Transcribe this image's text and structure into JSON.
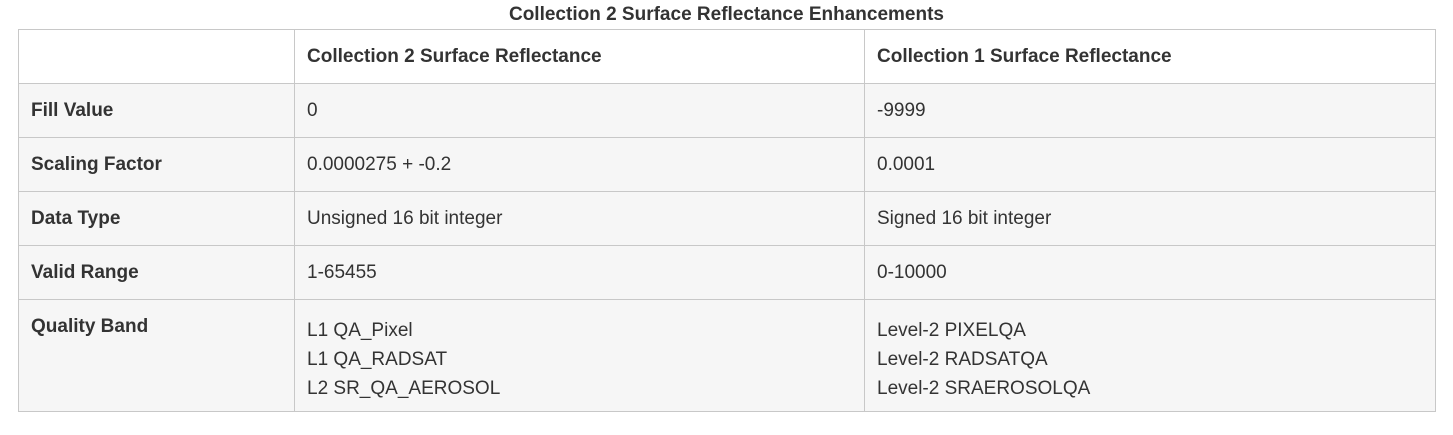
{
  "caption": "Collection 2 Surface Reflectance Enhancements",
  "table": {
    "headers": [
      "",
      "Collection 2 Surface Reflectance",
      "Collection 1 Surface Reflectance"
    ],
    "rows": [
      {
        "label": "Fill Value",
        "c2": [
          "0"
        ],
        "c1": [
          "-9999"
        ]
      },
      {
        "label": "Scaling Factor",
        "c2": [
          "0.0000275 + -0.2"
        ],
        "c1": [
          "0.0001"
        ]
      },
      {
        "label": "Data Type",
        "c2": [
          "Unsigned 16 bit integer"
        ],
        "c1": [
          "Signed 16 bit integer"
        ]
      },
      {
        "label": "Valid Range",
        "c2": [
          "1-65455"
        ],
        "c1": [
          "0-10000"
        ]
      },
      {
        "label": "Quality Band",
        "c2": [
          "L1 QA_Pixel",
          "L1 QA_RADSAT",
          "L2 SR_QA_AEROSOL"
        ],
        "c1": [
          "Level-2 PIXELQA",
          "Level-2 RADSATQA",
          "Level-2 SRAEROSOLQA"
        ]
      }
    ]
  },
  "colors": {
    "text": "#333333",
    "border": "#c8c8c8",
    "row_background": "#f6f6f6",
    "header_background": "#ffffff"
  }
}
